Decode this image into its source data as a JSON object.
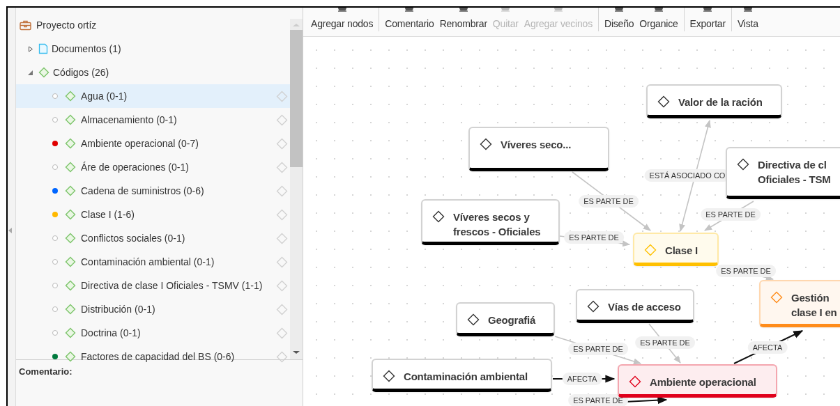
{
  "toolbar": {
    "groups": [
      {
        "buttons": [
          {
            "label": "Agregar nodos",
            "disabled": false
          }
        ]
      },
      {
        "buttons": [
          {
            "label": "Comentario",
            "disabled": false
          },
          {
            "label": "Renombrar",
            "disabled": false
          },
          {
            "label": "Quitar",
            "disabled": true
          },
          {
            "label": "Agregar vecinos",
            "disabled": true
          }
        ]
      },
      {
        "buttons": [
          {
            "label": "Diseño",
            "disabled": false
          },
          {
            "label": "Organice",
            "disabled": false
          }
        ]
      },
      {
        "buttons": [
          {
            "label": "Exportar",
            "disabled": false
          }
        ]
      },
      {
        "buttons": [
          {
            "label": "Vista",
            "disabled": false
          }
        ]
      }
    ]
  },
  "sidebar": {
    "project": "Proyecto ortíz",
    "folders": [
      {
        "label": "Documentos (1)",
        "kind": "documents",
        "expanded": false
      },
      {
        "label": "Códigos (26)",
        "kind": "codes",
        "expanded": true,
        "children": [
          {
            "label": "Agua (0-1)",
            "selected": true
          },
          {
            "label": "Almacenamiento (0-1)",
            "selected": false
          },
          {
            "label": "Ambiente operacional (0-7)",
            "selected": false,
            "color": "#e00000"
          },
          {
            "label": "Áre de operaciones (0-1)",
            "selected": false
          },
          {
            "label": "Cadena de suministros (0-6)",
            "selected": false,
            "color": "#0066ff"
          },
          {
            "label": "Clase I (1-6)",
            "selected": false,
            "color": "#ffb900"
          },
          {
            "label": "Conflictos sociales (0-1)",
            "selected": false
          },
          {
            "label": "Contaminación ambiental (0-1)",
            "selected": false
          },
          {
            "label": "Directiva de clase I Oficiales - TSMV (1-1)",
            "selected": false
          },
          {
            "label": "Distribución (0-1)",
            "selected": false
          },
          {
            "label": "Doctrina (0-1)",
            "selected": false
          },
          {
            "label": "Factores de capacidad del BS (0-6)",
            "selected": false,
            "color": "#007a3d"
          }
        ]
      }
    ],
    "comment_label": "Comentario:"
  },
  "diagram": {
    "nodes": [
      {
        "text": "Valor de la ración",
        "color": "#000000"
      },
      {
        "text": "Víveres seco...",
        "color": "#000000"
      },
      {
        "text": "Directiva de cl\nOficiales - TSM",
        "color": "#000000"
      },
      {
        "text": "Víveres secos y\nfrescos - Oficiales",
        "color": "#000000"
      },
      {
        "text": "Clase I",
        "color": "#ffc000"
      },
      {
        "text": "Gestión\nclase I en",
        "color": "#ff8c1a"
      },
      {
        "text": "Geografiá",
        "color": "#000000"
      },
      {
        "text": "Vías de acceso",
        "color": "#000000"
      },
      {
        "text": "Contaminación ambiental",
        "color": "#000000"
      },
      {
        "text": "Ambiente operacional",
        "color": "#e0001b"
      }
    ],
    "edges": [
      {
        "label": "ES PARTE DE",
        "kind": "light"
      },
      {
        "label": "ES PARTE DE",
        "kind": "light"
      },
      {
        "label": "ESTÁ ASOCIADO CO",
        "kind": "light"
      },
      {
        "label": "ES PARTE DE",
        "kind": "light"
      },
      {
        "label": "ES PARTE DE",
        "kind": "light"
      },
      {
        "label": "ES PARTE DE",
        "kind": "light"
      },
      {
        "label": "ES PARTE DE",
        "kind": "light"
      },
      {
        "label": "AFECTA",
        "kind": "strong"
      },
      {
        "label": "AFECTA",
        "kind": "strong"
      },
      {
        "label": "ES PARTE DE",
        "kind": "strong"
      }
    ]
  }
}
